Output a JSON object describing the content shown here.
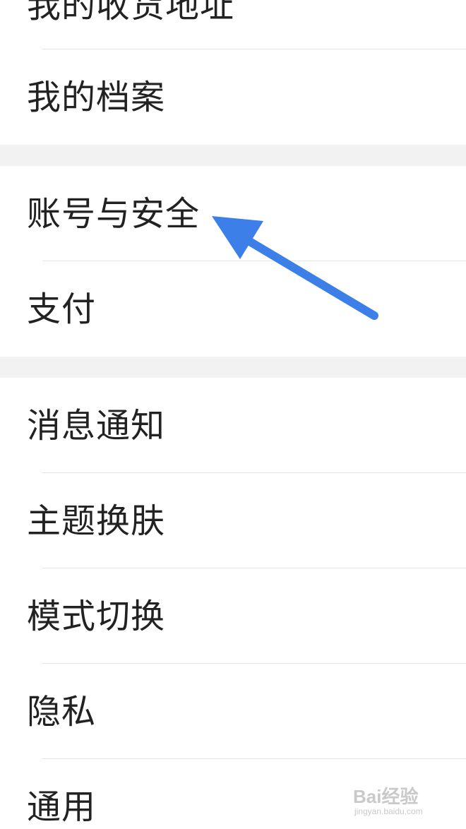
{
  "settings_list": {
    "group1": {
      "items": [
        {
          "label": "我的收货地址"
        },
        {
          "label": "我的档案"
        }
      ]
    },
    "group2": {
      "items": [
        {
          "label": "账号与安全"
        },
        {
          "label": "支付"
        }
      ]
    },
    "group3": {
      "items": [
        {
          "label": "消息通知"
        },
        {
          "label": "主题换肤"
        },
        {
          "label": "模式切换"
        },
        {
          "label": "隐私"
        },
        {
          "label": "通用"
        }
      ]
    }
  },
  "annotation": {
    "arrow_color": "#3d7fe8",
    "points_to": "账号与安全"
  },
  "watermark": {
    "text": "Bai经验",
    "sub": "jingyan.baidu.com"
  },
  "colors": {
    "background": "#ffffff",
    "section_gap": "#f2f2f2",
    "divider": "#e6e6e6",
    "text": "#222222"
  }
}
